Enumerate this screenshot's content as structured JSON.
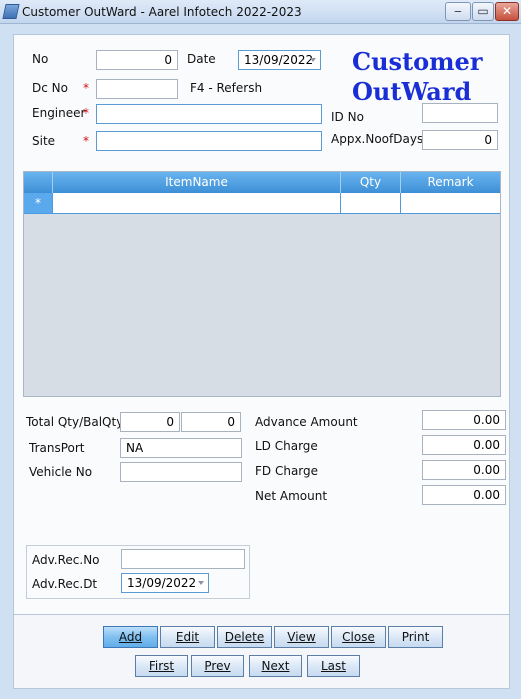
{
  "window": {
    "title": "Customer OutWard - Aarel Infotech 2022-2023",
    "minimize_glyph": "‒",
    "maximize_glyph": "▭",
    "close_glyph": "✕"
  },
  "form": {
    "heading_line1": "Customer",
    "heading_line2": "OutWard",
    "required_mark": "*",
    "no_label": "No",
    "no_value": "0",
    "date_label": "Date",
    "date_value": "13/09/2022",
    "dcno_label": "Dc No",
    "dcno_value": "",
    "refresh_hint": "F4 - Refersh",
    "engineer_label": "Engineer",
    "engineer_value": "",
    "idno_label": "ID No",
    "idno_value": "",
    "site_label": "Site",
    "site_value": "",
    "days_label": "Appx.NoofDays",
    "days_value": "0"
  },
  "grid": {
    "columns": [
      "ItemName",
      "Qty",
      "Remark"
    ],
    "new_row_marker": "*"
  },
  "totals": {
    "total_qty_label": "Total Qty/BalQty",
    "total_qty": "0",
    "bal_qty": "0",
    "transport_label": "TransPort",
    "transport_value": "NA",
    "vehicle_label": "Vehicle No",
    "vehicle_value": "",
    "advance_label": "Advance Amount",
    "advance_value": "0.00",
    "ld_label": "LD Charge",
    "ld_value": "0.00",
    "fd_label": "FD Charge",
    "fd_value": "0.00",
    "net_label": "Net Amount",
    "net_value": "0.00",
    "adv_rec_no_label": "Adv.Rec.No",
    "adv_rec_no_value": "",
    "adv_rec_dt_label": "Adv.Rec.Dt",
    "adv_rec_dt_value": "13/09/2022"
  },
  "buttons": {
    "add": "Add",
    "edit": "Edit",
    "delete": "Delete",
    "view": "View",
    "close": "Close",
    "print": "Print",
    "first": "First",
    "prev": "Prev",
    "next": "Next",
    "last": "Last"
  }
}
